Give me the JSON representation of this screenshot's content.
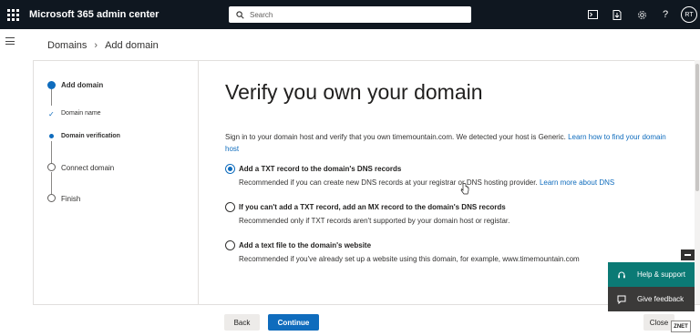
{
  "topbar": {
    "app_title": "Microsoft 365 admin center",
    "search_placeholder": "Search",
    "avatar_initials": "RT"
  },
  "breadcrumb": {
    "root": "Domains",
    "current": "Add domain"
  },
  "steps": [
    {
      "label": "Add domain",
      "state": "current"
    },
    {
      "label": "Domain name",
      "state": "complete"
    },
    {
      "label": "Domain verification",
      "state": "current-sub"
    },
    {
      "label": "Connect domain",
      "state": "pending"
    },
    {
      "label": "Finish",
      "state": "pending"
    }
  ],
  "main": {
    "heading": "Verify you own your domain",
    "description": "Sign in to your domain host and verify that you own timemountain.com. We detected your host is Generic.",
    "description_link": "Learn how to find your domain host",
    "options": [
      {
        "title": "Add a TXT record to the domain's DNS records",
        "subtitle": "Recommended if you can create new DNS records at your registrar or DNS hosting provider.",
        "link": "Learn more about DNS",
        "selected": true
      },
      {
        "title": "If you can't add a TXT record, add an MX record to the domain's DNS records",
        "subtitle": "Recommended only if TXT records aren't supported by your domain host or registar.",
        "selected": false
      },
      {
        "title": "Add a text file to the domain's website",
        "subtitle": "Recommended if you've already set up a website using this domain, for example, www.timemountain.com",
        "selected": false
      }
    ]
  },
  "footer": {
    "back_label": "Back",
    "continue_label": "Continue",
    "close_label": "Close"
  },
  "side_panel": {
    "help_label": "Help & support",
    "feedback_label": "Give feedback"
  },
  "watermark": "ZNET",
  "colors": {
    "topbar": "#0f1720",
    "accent": "#0f6cbd",
    "help": "#0b7a75",
    "feedback": "#3b3a39"
  },
  "icons": [
    "waffle-icon",
    "search-icon",
    "terminal-icon",
    "download-icon",
    "gear-icon",
    "help-icon",
    "hamburger-icon",
    "cursor-icon"
  ]
}
